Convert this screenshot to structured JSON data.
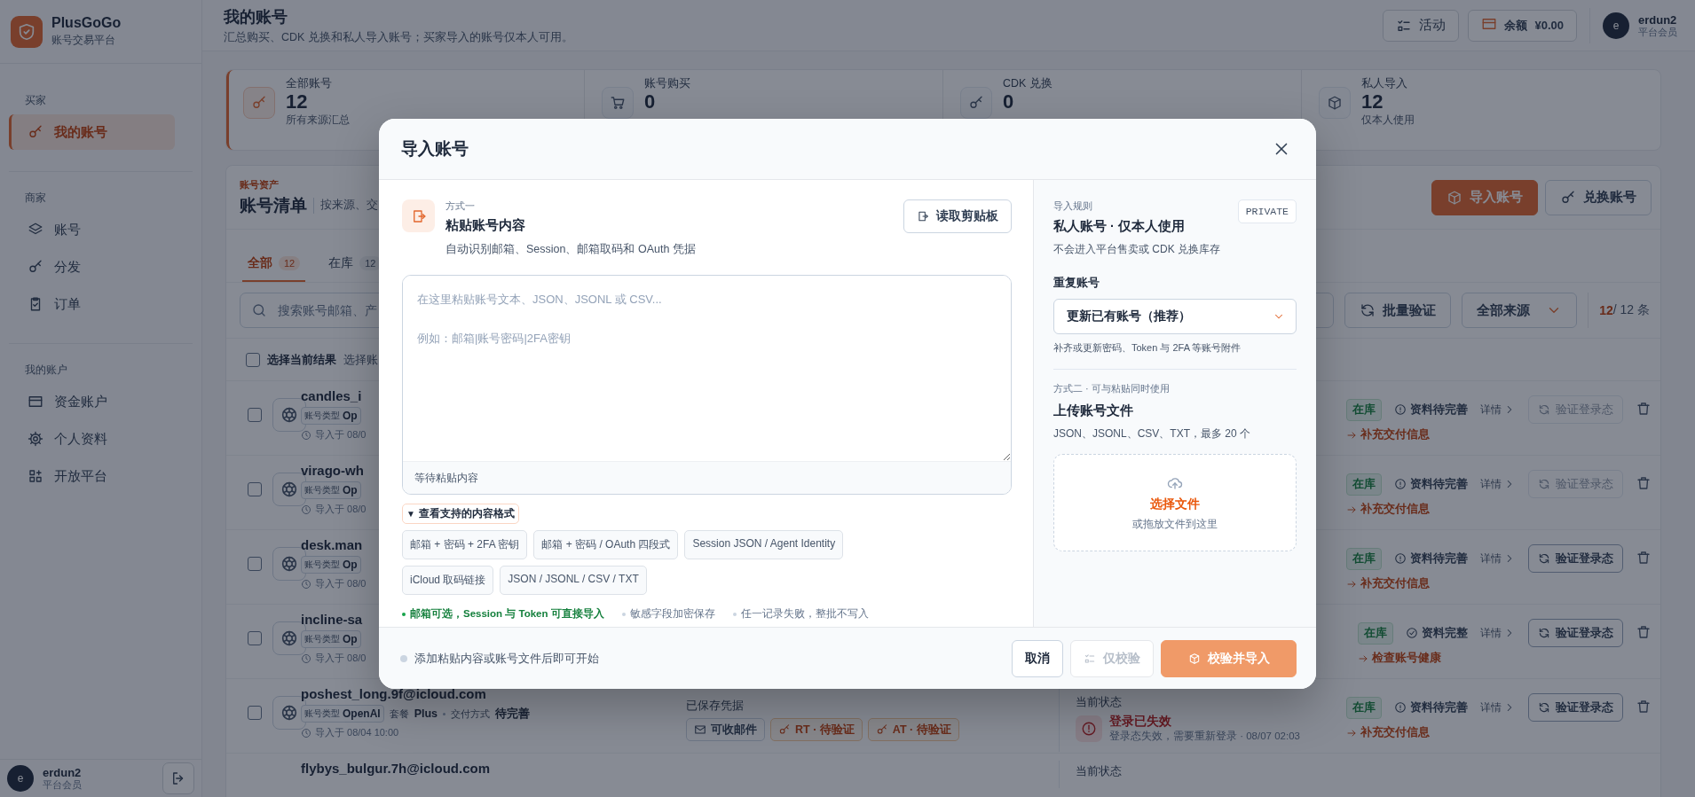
{
  "sidebar": {
    "brand": {
      "name": "PlusGoGo",
      "tagline": "账号交易平台"
    },
    "sections": [
      {
        "title": "买家",
        "items": [
          {
            "label": "我的账号",
            "selected": true
          }
        ]
      },
      {
        "title": "商家",
        "items": [
          {
            "label": "账号",
            "selected": false
          },
          {
            "label": "分发",
            "selected": false
          },
          {
            "label": "订单",
            "selected": false
          }
        ]
      },
      {
        "title": "我的账户",
        "items": [
          {
            "label": "资金账户",
            "selected": false
          },
          {
            "label": "个人资料",
            "selected": false
          },
          {
            "label": "开放平台",
            "selected": false
          }
        ]
      }
    ],
    "user": {
      "avatar": "e",
      "name": "erdun2",
      "role": "平台会员"
    }
  },
  "header": {
    "title": "我的账号",
    "subtitle": "汇总购买、CDK 兑换和私人导入账号；买家导入的账号仅本人可用。",
    "activity": "活动",
    "balance": {
      "label": "余额",
      "amount": "¥0.00"
    },
    "user": {
      "avatar": "e",
      "name": "erdun2",
      "role": "平台会员"
    }
  },
  "stats": [
    {
      "label": "全部账号",
      "value": "12",
      "note": "所有来源汇总",
      "selected": true
    },
    {
      "label": "账号购买",
      "value": "0",
      "selected": false
    },
    {
      "label": "CDK 兑换",
      "value": "0",
      "selected": false
    },
    {
      "label": "私人导入",
      "value": "12",
      "note": "仅本人使用",
      "selected": false
    }
  ],
  "list": {
    "eyebrow": "账号资产",
    "title": "账号清单",
    "description": "按来源、交",
    "actions": [
      {
        "label": "导入账号",
        "primary": true
      },
      {
        "label": "兑换账号",
        "primary": false
      }
    ],
    "tabs": [
      {
        "label": "全部",
        "count": "12",
        "selected": true
      },
      {
        "label": "在库",
        "count": "12",
        "selected": false
      }
    ],
    "search": {
      "placeholder": "搜索账号邮箱、产"
    },
    "bulk_verify": "批量验证",
    "source_filter": "全部来源",
    "count": {
      "shown": "12",
      "total": "/ 12 条"
    },
    "select_all": {
      "label": "选择当前结果",
      "checked": false,
      "hint": "选择账"
    },
    "rows": [
      {
        "name": "candles_i",
        "checked": false,
        "meta": {
          "label": "账号类型",
          "value": "Op"
        },
        "imported": "导入于 08/0",
        "stock": "在库",
        "profile": {
          "text": "资料待完善",
          "complete": false
        },
        "detail": "详情",
        "verify": {
          "label": "验证登录态",
          "disabled": true
        },
        "next": "补充交付信息"
      },
      {
        "name": "virago-wh",
        "checked": false,
        "meta": {
          "label": "账号类型",
          "value": "Op"
        },
        "imported": "导入于 08/0",
        "stock": "在库",
        "profile": {
          "text": "资料待完善",
          "complete": false
        },
        "detail": "详情",
        "verify": {
          "label": "验证登录态",
          "disabled": true
        },
        "next": "补充交付信息"
      },
      {
        "name": "desk.man",
        "checked": false,
        "meta": {
          "label": "账号类型",
          "value": "Op"
        },
        "imported": "导入于 08/0",
        "stock": "在库",
        "profile": {
          "text": "资料待完善",
          "complete": false
        },
        "detail": "详情",
        "verify": {
          "label": "验证登录态",
          "disabled": false
        },
        "next": "补充交付信息"
      },
      {
        "name": "incline-sa",
        "checked": false,
        "meta": {
          "label": "账号类型",
          "value": "Op"
        },
        "imported": "导入于 08/0",
        "stock": "在库",
        "profile": {
          "text": "资料完整",
          "complete": true
        },
        "detail": "详情",
        "verify": {
          "label": "验证登录态",
          "disabled": false
        },
        "next": "检查账号健康"
      },
      {
        "name": "poshest_long.9f@icloud.com",
        "checked": false,
        "meta": {
          "label": "账号类型",
          "value": "OpenAI"
        },
        "plan": {
          "label": "套餐",
          "value": "Plus"
        },
        "delivery": {
          "label": "交付方式",
          "value": "待完善"
        },
        "imported": "导入于 08/04 10:00",
        "credentials": {
          "label": "已保存凭据",
          "items": [
            {
              "label": "可收邮件",
              "kind": "mail"
            },
            {
              "label": "RT · 待验证",
              "kind": "key"
            },
            {
              "label": "AT · 待验证",
              "kind": "key"
            }
          ]
        },
        "status": {
          "label": "当前状态",
          "title": "登录已失效",
          "detail": "登录态失效，需要重新登录 · 08/07 02:03"
        },
        "stock": "在库",
        "profile": {
          "text": "资料待完善",
          "complete": false
        },
        "detail": "详情",
        "verify": {
          "label": "验证登录态",
          "disabled": false
        },
        "next": "补充交付信息"
      },
      {
        "name": "flybys_bulgur.7h@icloud.com",
        "status": {
          "label": "当前状态"
        }
      }
    ]
  },
  "modal": {
    "title": "导入账号",
    "paste": {
      "step": "方式一",
      "title": "粘贴账号内容",
      "description": "自动识别邮箱、Session、邮箱取码和 OAuth 凭据",
      "clipboard_button": "读取剪贴板",
      "placeholder": "在这里粘贴账号文本、JSON、JSONL 或 CSV...\n\n例如：邮箱|账号密码|2FA密钥",
      "status": "等待粘贴内容",
      "formats": {
        "toggle": "▼",
        "label": "查看支持的内容格式",
        "expanded": true,
        "items": [
          "邮箱 + 密码 + 2FA 密钥",
          "邮箱 + 密码 / OAuth 四段式",
          "Session JSON / Agent Identity",
          "iCloud 取码链接",
          "JSON / JSONL / CSV / TXT"
        ]
      },
      "notes": [
        {
          "text": "邮箱可选，Session 与 Token 可直接导入",
          "kind": "success"
        },
        {
          "text": "敏感字段加密保存",
          "kind": "neutral"
        },
        {
          "text": "任一记录失败，整批不写入",
          "kind": "neutral"
        }
      ]
    },
    "rules": {
      "eyebrow": "导入规则",
      "title": "私人账号 · 仅本人使用",
      "badge": "PRIVATE",
      "description": "不会进入平台售卖或 CDK 兑换库存",
      "duplicate": {
        "label": "重复账号",
        "value": "更新已有账号（推荐）",
        "hint": "补齐或更新密码、Token 与 2FA 等账号附件"
      }
    },
    "upload": {
      "step": "方式二 · 可与粘贴同时使用",
      "title": "上传账号文件",
      "description": "JSON、JSONL、CSV、TXT，最多 20 个",
      "action": "选择文件",
      "hint": "或拖放文件到这里"
    },
    "footer": {
      "status": "添加粘贴内容或账号文件后即可开始",
      "buttons": [
        {
          "label": "取消",
          "kind": "cancel",
          "disabled": false
        },
        {
          "label": "仅校验",
          "kind": "validate",
          "disabled": true
        },
        {
          "label": "校验并导入",
          "kind": "import",
          "disabled": true
        }
      ]
    }
  }
}
